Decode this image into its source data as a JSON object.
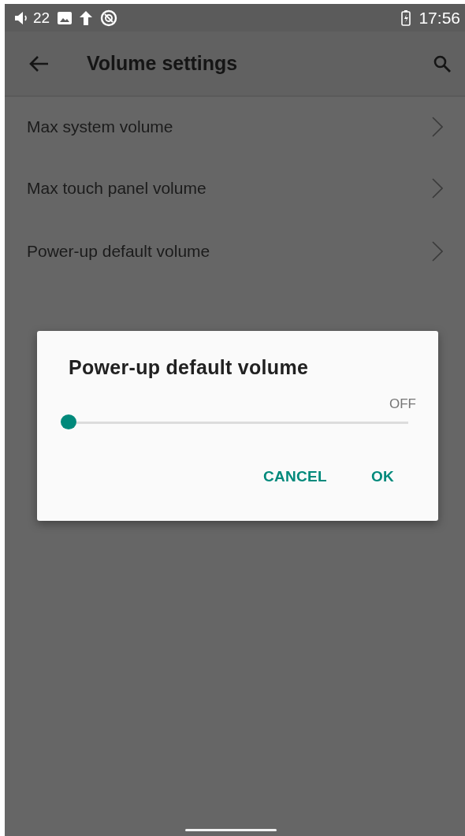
{
  "status_bar": {
    "volume": "22",
    "time": "17:56"
  },
  "toolbar": {
    "title": "Volume settings"
  },
  "settings": [
    {
      "label": "Max system volume"
    },
    {
      "label": "Max touch panel volume"
    },
    {
      "label": "Power-up default volume"
    }
  ],
  "dialog": {
    "title": "Power-up default volume",
    "reading": "OFF",
    "level": 0,
    "buttons": [
      "CANCEL",
      "OK"
    ]
  }
}
